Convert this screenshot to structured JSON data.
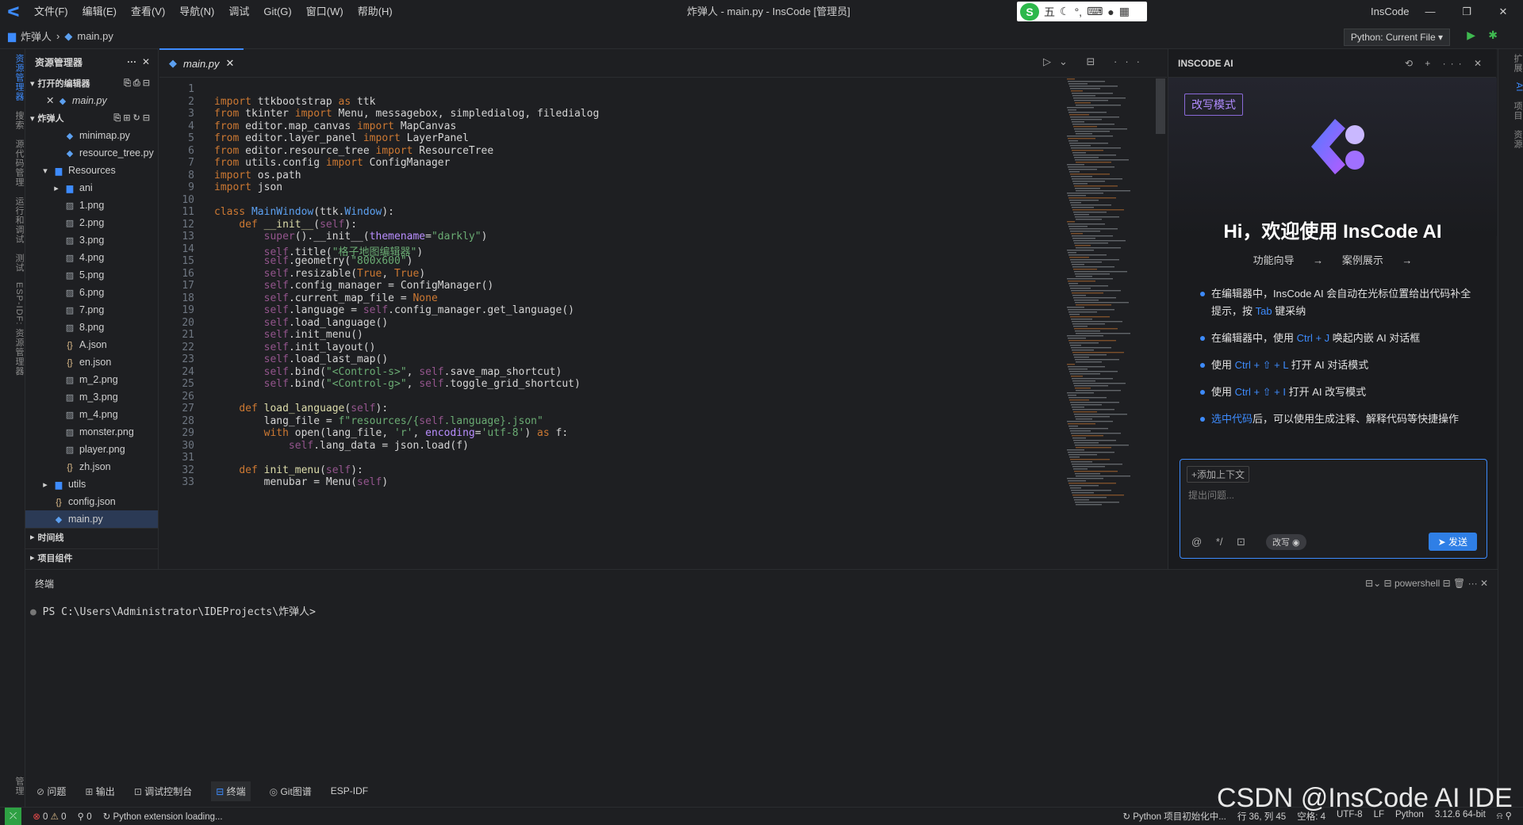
{
  "titlebar": {
    "menus": [
      "文件(F)",
      "编辑(E)",
      "查看(V)",
      "导航(N)",
      "调试",
      "Git(G)",
      "窗口(W)",
      "帮助(H)"
    ],
    "title": "炸弹人 - main.py - InsCode [管理员]",
    "brand": "InsCode",
    "ime": "五"
  },
  "breadcrumb": {
    "project": "炸弹人",
    "file": "main.py"
  },
  "run_config": "Python: Current File",
  "activity_left": [
    "资源管理器",
    "搜索",
    "源代码管理",
    "运行和调试",
    "测试",
    "ESP-IDF: 资源管理器",
    "管理"
  ],
  "activity_right": [
    "扩展",
    "AI",
    "项目",
    "资源"
  ],
  "explorer": {
    "title": "资源管理器",
    "open_editors_label": "打开的编辑器",
    "open_editor_file": "main.py",
    "project_label": "炸弹人",
    "files": [
      {
        "name": "minimap.py",
        "type": "py",
        "indent": 2
      },
      {
        "name": "resource_tree.py",
        "type": "py",
        "indent": 2
      },
      {
        "name": "Resources",
        "type": "folder-open",
        "indent": 1
      },
      {
        "name": "ani",
        "type": "folder",
        "indent": 2
      },
      {
        "name": "1.png",
        "type": "png",
        "indent": 2
      },
      {
        "name": "2.png",
        "type": "png",
        "indent": 2
      },
      {
        "name": "3.png",
        "type": "png",
        "indent": 2
      },
      {
        "name": "4.png",
        "type": "png",
        "indent": 2
      },
      {
        "name": "5.png",
        "type": "png",
        "indent": 2
      },
      {
        "name": "6.png",
        "type": "png",
        "indent": 2
      },
      {
        "name": "7.png",
        "type": "png",
        "indent": 2
      },
      {
        "name": "8.png",
        "type": "png",
        "indent": 2
      },
      {
        "name": "A.json",
        "type": "json",
        "indent": 2
      },
      {
        "name": "en.json",
        "type": "json",
        "indent": 2
      },
      {
        "name": "m_2.png",
        "type": "png",
        "indent": 2
      },
      {
        "name": "m_3.png",
        "type": "png",
        "indent": 2
      },
      {
        "name": "m_4.png",
        "type": "png",
        "indent": 2
      },
      {
        "name": "monster.png",
        "type": "png",
        "indent": 2
      },
      {
        "name": "player.png",
        "type": "png",
        "indent": 2
      },
      {
        "name": "zh.json",
        "type": "json",
        "indent": 2
      },
      {
        "name": "utils",
        "type": "folder",
        "indent": 1
      },
      {
        "name": "config.json",
        "type": "json",
        "indent": 1
      },
      {
        "name": "main.py",
        "type": "py",
        "indent": 1,
        "selected": true
      }
    ],
    "timeline_label": "时间线",
    "components_label": "项目组件"
  },
  "editor": {
    "tab": "main.py",
    "lines": [
      [],
      [
        [
          "kw",
          "import"
        ],
        [
          "t",
          " ttkbootstrap "
        ],
        [
          "kw",
          "as"
        ],
        [
          "t",
          " ttk"
        ]
      ],
      [
        [
          "kw",
          "from"
        ],
        [
          "t",
          " tkinter "
        ],
        [
          "kw",
          "import"
        ],
        [
          "t",
          " Menu, messagebox, simpledialog, filedialog"
        ]
      ],
      [
        [
          "kw",
          "from"
        ],
        [
          "t",
          " editor.map_canvas "
        ],
        [
          "kw",
          "import"
        ],
        [
          "t",
          " MapCanvas"
        ]
      ],
      [
        [
          "kw",
          "from"
        ],
        [
          "t",
          " editor.layer_panel "
        ],
        [
          "kw",
          "import"
        ],
        [
          "t",
          " LayerPanel"
        ]
      ],
      [
        [
          "kw",
          "from"
        ],
        [
          "t",
          " editor.resource_tree "
        ],
        [
          "kw",
          "import"
        ],
        [
          "t",
          " ResourceTree"
        ]
      ],
      [
        [
          "kw",
          "from"
        ],
        [
          "t",
          " utils.config "
        ],
        [
          "kw",
          "import"
        ],
        [
          "t",
          " ConfigManager"
        ]
      ],
      [
        [
          "kw",
          "import"
        ],
        [
          "t",
          " os.path"
        ]
      ],
      [
        [
          "kw",
          "import"
        ],
        [
          "t",
          " json"
        ]
      ],
      [],
      [
        [
          "kw",
          "class"
        ],
        [
          "t",
          " "
        ],
        [
          "bl",
          "MainWindow"
        ],
        [
          "t",
          "(ttk."
        ],
        [
          "bl",
          "Window"
        ],
        [
          "t",
          "):"
        ]
      ],
      [
        [
          "t",
          "    "
        ],
        [
          "kw",
          "def"
        ],
        [
          "t",
          " "
        ],
        [
          "fn",
          "__init__"
        ],
        [
          "t",
          "("
        ],
        [
          "sf",
          "self"
        ],
        [
          "t",
          "):"
        ]
      ],
      [
        [
          "t",
          "        "
        ],
        [
          "sf",
          "super"
        ],
        [
          "t",
          "().__init__("
        ],
        [
          "pr",
          "themename"
        ],
        [
          "t",
          "="
        ],
        [
          "st",
          "\"darkly\""
        ],
        [
          "t",
          ")"
        ]
      ],
      [
        [
          "t",
          "        "
        ],
        [
          "sf",
          "self"
        ],
        [
          "t",
          ".title("
        ],
        [
          "st",
          "\"格子地图编辑器\""
        ],
        [
          "t",
          ")"
        ]
      ],
      [
        [
          "t",
          "        "
        ],
        [
          "sf",
          "self"
        ],
        [
          "t",
          ".geometry("
        ],
        [
          "st",
          "\"800x600\""
        ],
        [
          "t",
          ")"
        ]
      ],
      [
        [
          "t",
          "        "
        ],
        [
          "sf",
          "self"
        ],
        [
          "t",
          ".resizable("
        ],
        [
          "kw",
          "True"
        ],
        [
          "t",
          ", "
        ],
        [
          "kw",
          "True"
        ],
        [
          "t",
          ")"
        ]
      ],
      [
        [
          "t",
          "        "
        ],
        [
          "sf",
          "self"
        ],
        [
          "t",
          ".config_manager = ConfigManager()"
        ]
      ],
      [
        [
          "t",
          "        "
        ],
        [
          "sf",
          "self"
        ],
        [
          "t",
          ".current_map_file = "
        ],
        [
          "kw",
          "None"
        ]
      ],
      [
        [
          "t",
          "        "
        ],
        [
          "sf",
          "self"
        ],
        [
          "t",
          ".language = "
        ],
        [
          "sf",
          "self"
        ],
        [
          "t",
          ".config_manager.get_language()"
        ]
      ],
      [
        [
          "t",
          "        "
        ],
        [
          "sf",
          "self"
        ],
        [
          "t",
          ".load_language()"
        ]
      ],
      [
        [
          "t",
          "        "
        ],
        [
          "sf",
          "self"
        ],
        [
          "t",
          ".init_menu()"
        ]
      ],
      [
        [
          "t",
          "        "
        ],
        [
          "sf",
          "self"
        ],
        [
          "t",
          ".init_layout()"
        ]
      ],
      [
        [
          "t",
          "        "
        ],
        [
          "sf",
          "self"
        ],
        [
          "t",
          ".load_last_map()"
        ]
      ],
      [
        [
          "t",
          "        "
        ],
        [
          "sf",
          "self"
        ],
        [
          "t",
          ".bind("
        ],
        [
          "st",
          "\"<Control-s>\""
        ],
        [
          "t",
          ", "
        ],
        [
          "sf",
          "self"
        ],
        [
          "t",
          ".save_map_shortcut)"
        ]
      ],
      [
        [
          "t",
          "        "
        ],
        [
          "sf",
          "self"
        ],
        [
          "t",
          ".bind("
        ],
        [
          "st",
          "\"<Control-g>\""
        ],
        [
          "t",
          ", "
        ],
        [
          "sf",
          "self"
        ],
        [
          "t",
          ".toggle_grid_shortcut)"
        ]
      ],
      [],
      [
        [
          "t",
          "    "
        ],
        [
          "kw",
          "def"
        ],
        [
          "t",
          " "
        ],
        [
          "fn",
          "load_language"
        ],
        [
          "t",
          "("
        ],
        [
          "sf",
          "self"
        ],
        [
          "t",
          "):"
        ]
      ],
      [
        [
          "t",
          "        lang_file = "
        ],
        [
          "st",
          "f\"resources/{"
        ],
        [
          "sf",
          "self"
        ],
        [
          "st",
          ".language}.json\""
        ]
      ],
      [
        [
          "t",
          "        "
        ],
        [
          "kw",
          "with"
        ],
        [
          "t",
          " open(lang_file, "
        ],
        [
          "st",
          "'r'"
        ],
        [
          "t",
          ", "
        ],
        [
          "pr",
          "encoding"
        ],
        [
          "t",
          "="
        ],
        [
          "st",
          "'utf-8'"
        ],
        [
          "t",
          ") "
        ],
        [
          "kw",
          "as"
        ],
        [
          "t",
          " f:"
        ]
      ],
      [
        [
          "t",
          "            "
        ],
        [
          "sf",
          "self"
        ],
        [
          "t",
          ".lang_data = json.load(f)"
        ]
      ],
      [],
      [
        [
          "t",
          "    "
        ],
        [
          "kw",
          "def"
        ],
        [
          "t",
          " "
        ],
        [
          "fn",
          "init_menu"
        ],
        [
          "t",
          "("
        ],
        [
          "sf",
          "self"
        ],
        [
          "t",
          "):"
        ]
      ],
      [
        [
          "t",
          "        menubar = Menu("
        ],
        [
          "sf",
          "self"
        ],
        [
          "t",
          ")"
        ]
      ]
    ]
  },
  "ai": {
    "header": "INSCODE AI",
    "mode_badge": "改写模式",
    "welcome": "Hi，欢迎使用 InsCode AI",
    "links": [
      "功能向导 →",
      "案例展示 →"
    ],
    "tips": [
      [
        [
          "t",
          "在编辑器中，InsCode AI 会自动在光标位置给出代码补全提示，按 "
        ],
        [
          "h",
          "Tab"
        ],
        [
          "t",
          " 键采纳"
        ]
      ],
      [
        [
          "t",
          "在编辑器中，使用 "
        ],
        [
          "h",
          "Ctrl + J"
        ],
        [
          "t",
          " 唤起内嵌 AI 对话框"
        ]
      ],
      [
        [
          "t",
          "使用 "
        ],
        [
          "h",
          "Ctrl + ⇧ + L"
        ],
        [
          "t",
          " 打开 AI 对话模式"
        ]
      ],
      [
        [
          "t",
          "使用 "
        ],
        [
          "h",
          "Ctrl + ⇧ + I"
        ],
        [
          "t",
          " 打开 AI 改写模式"
        ]
      ],
      [
        [
          "h",
          "选中代码"
        ],
        [
          "t",
          "后，可以使用生成注释、解释代码等快捷操作"
        ]
      ]
    ],
    "add_context": "+添加上下文",
    "placeholder": "提出问题...",
    "mode_chip": "改写",
    "send": "发送"
  },
  "panel": {
    "title": "终端",
    "shell": "powershell",
    "prompt": "PS C:\\Users\\Administrator\\IDEProjects\\炸弹人>"
  },
  "bottom_tabs": [
    "问题",
    "输出",
    "调试控制台",
    "终端",
    "Git图谱",
    "ESP-IDF"
  ],
  "status": {
    "errors": "0",
    "warnings": "0",
    "ports": "0",
    "loading": "Python extension loading...",
    "init": "Python 项目初始化中...",
    "position": "行 36, 列 45",
    "spaces": "空格: 4",
    "encoding": "UTF-8",
    "eol": "LF",
    "lang": "Python",
    "interpreter": "3.12.6 64-bit"
  },
  "watermark": "CSDN @InsCode AI IDE"
}
